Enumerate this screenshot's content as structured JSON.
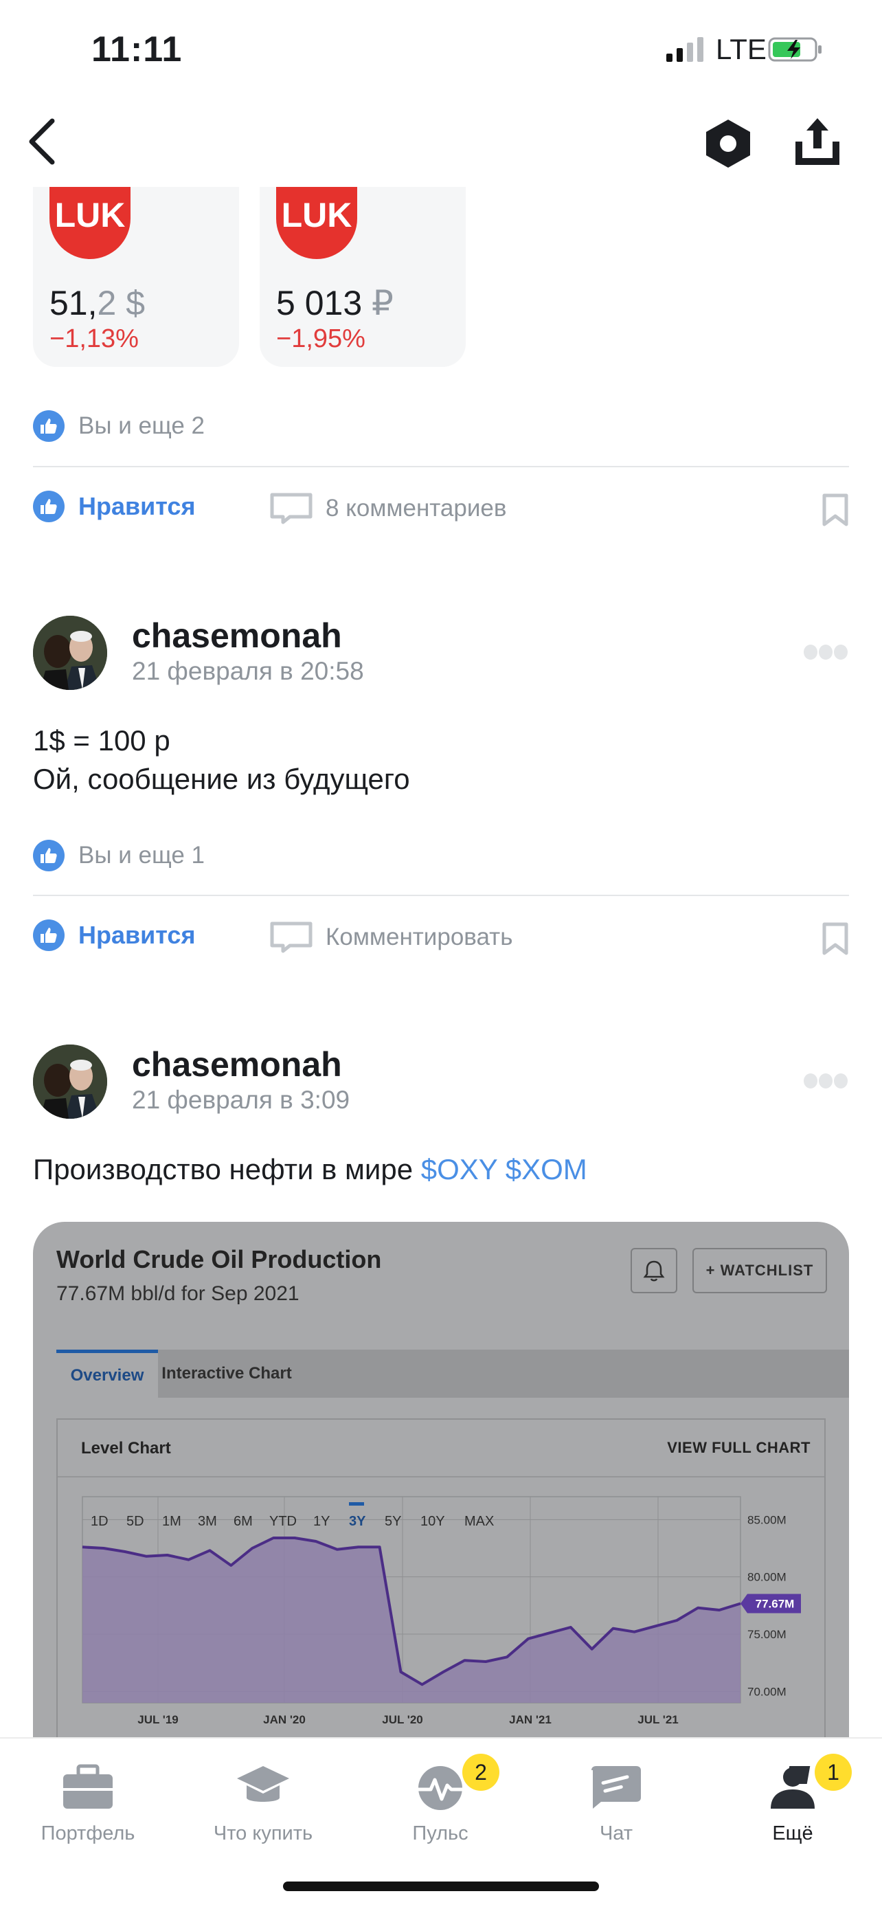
{
  "status_bar": {
    "time": "11:11",
    "network": "LTE"
  },
  "tickers": [
    {
      "price_main": "51,",
      "price_dim": "2 $",
      "change": "−1,13%"
    },
    {
      "price_main": "5 013 ",
      "price_dim": "₽",
      "change": "−1,95%"
    }
  ],
  "posts": [
    {
      "likes_text": "Вы и еще 2",
      "like_label": "Нравится",
      "comment_label": "8 комментариев"
    },
    {
      "username": "chasemonah",
      "date": "21 февраля в 20:58",
      "text_line1": "1$ = 100 р",
      "text_line2": "Ой, сообщение из будущего",
      "likes_text": "Вы и еще 1",
      "like_label": "Нравится",
      "comment_label": "Комментировать"
    },
    {
      "username": "chasemonah",
      "date": "21 февраля в 3:09",
      "text": "Производство нефти в мире ",
      "tags": "$OXY $XOM"
    }
  ],
  "embed": {
    "title": "World Crude Oil Production",
    "subtitle": "77.67M bbl/d for Sep 2021",
    "watchlist_label": "+ WATCHLIST",
    "tab_overview": "Overview",
    "tab_interactive": "Interactive Chart",
    "panel_title": "Level Chart",
    "panel_link": "VIEW FULL CHART"
  },
  "chart_data": {
    "type": "area",
    "title": "Level Chart",
    "range_buttons": [
      "1D",
      "5D",
      "1M",
      "3M",
      "6M",
      "YTD",
      "1Y",
      "3Y",
      "5Y",
      "10Y",
      "MAX"
    ],
    "selected_range": "3Y",
    "x_ticks": [
      "JUL '19",
      "JAN '20",
      "JUL '20",
      "JAN '21",
      "JUL '21"
    ],
    "y_ticks": [
      "85.00M",
      "80.00M",
      "75.00M",
      "70.00M"
    ],
    "ylim": [
      69,
      87
    ],
    "last_value_label": "77.67M",
    "series": [
      {
        "values": [
          82.6,
          82.5,
          82.2,
          81.8,
          81.9,
          81.5,
          82.3,
          81.0,
          82.5,
          83.4,
          83.4,
          83.1,
          82.4,
          82.6,
          82.6,
          71.7,
          70.6,
          71.7,
          72.7,
          72.6,
          73.0,
          74.6,
          75.1,
          75.6,
          73.7,
          75.5,
          75.2,
          75.7,
          76.2,
          77.3,
          77.1,
          77.67
        ]
      }
    ]
  },
  "tabbar": [
    {
      "label": "Портфель"
    },
    {
      "label": "Что купить"
    },
    {
      "label": "Пульс",
      "badge": "2"
    },
    {
      "label": "Чат"
    },
    {
      "label": "Ещё",
      "badge": "1"
    }
  ]
}
